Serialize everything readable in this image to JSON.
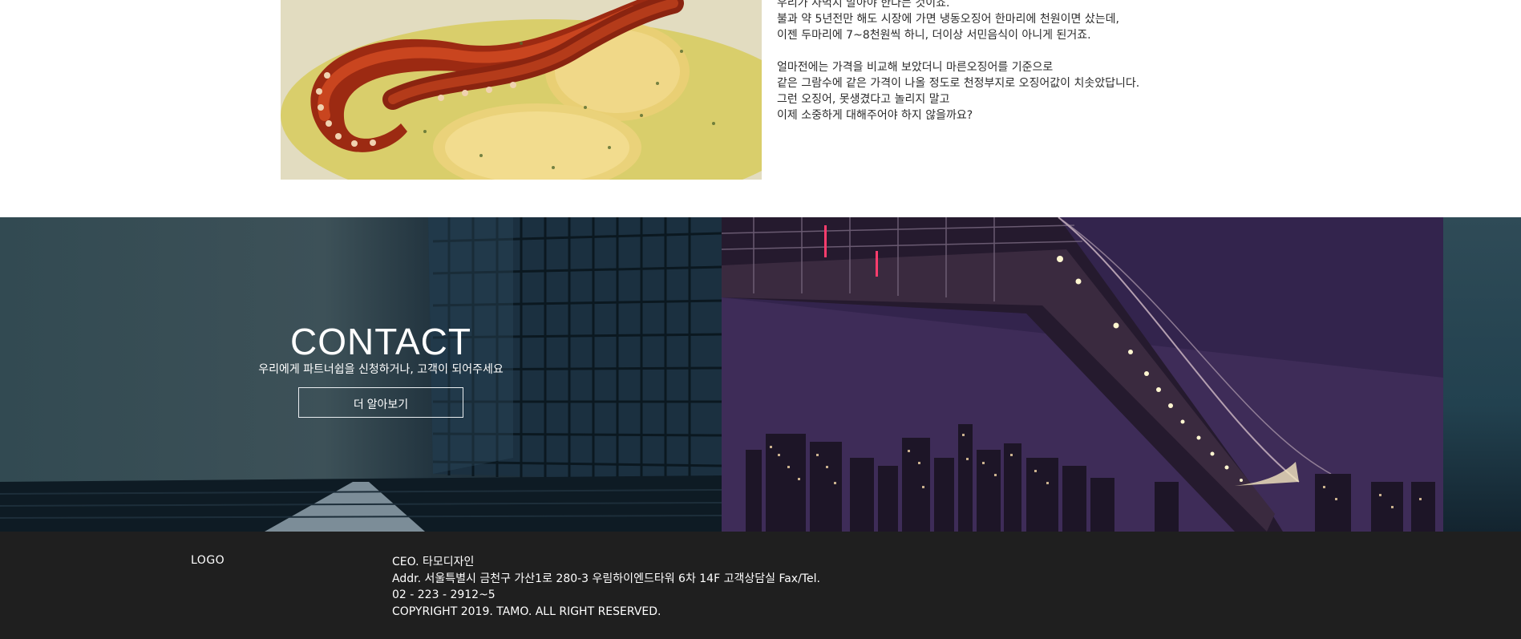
{
  "story": {
    "paragraphs": [
      [
        "우리가 사먹지 말아야 한다는 것이죠.",
        "불과 약 5년전만 해도 시장에 가면 냉동오징어 한마리에 천원이면 샀는데,",
        "이젠 두마리에 7~8천원씩 하니, 더이상 서민음식이 아니게 된거죠."
      ],
      [
        "얼마전에는 가격을 비교해 보았더니 마른오징어를 기준으로",
        "같은 그람수에 같은 가격이 나올 정도로 천정부지로 오징어값이 치솟았답니다.",
        "그런 오징어, 못생겼다고 놀리지 말고",
        "이제 소중하게 대해주어야 하지 않을까요?"
      ]
    ]
  },
  "contact": {
    "title": "CONTACT",
    "subtitle": "우리에게 파트너쉽을 신청하거나, 고객이 되어주세요",
    "button_label": "더 알아보기"
  },
  "footer": {
    "logo": "LOGO",
    "ceo": "CEO. 타모디자인",
    "address": "Addr. 서울특별시 금천구 가산1로 280-3 우림하이엔드타워 6차 14F 고객상담실 Fax/Tel.",
    "phone": "02 - 223 - 2912~5",
    "copyright": "COPYRIGHT 2019. TAMO. ALL RIGHT RESERVED."
  },
  "colors": {
    "footer_bg": "#1f1f1f",
    "text_dark": "#2b2b2b",
    "white": "#ffffff"
  }
}
